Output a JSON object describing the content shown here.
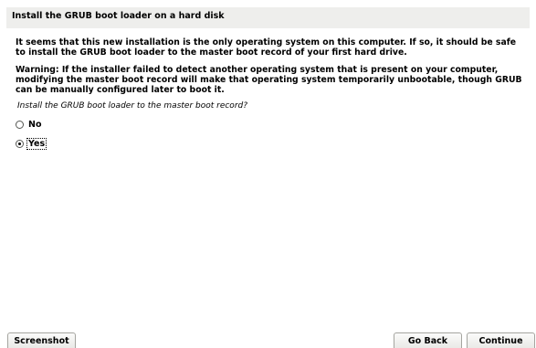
{
  "title": "Install the GRUB boot loader on a hard disk",
  "paragraphs": [
    "It seems that this new installation is the only operating system on this computer. If so, it should be safe to install the GRUB boot loader to the master boot record of your first hard drive.",
    "Warning: If the installer failed to detect another operating system that is present on your computer, modifying the master boot record will make that operating system temporarily unbootable, though GRUB can be manually configured later to boot it."
  ],
  "question": "Install the GRUB boot loader to the master boot record?",
  "options": [
    {
      "label": "No",
      "selected": false
    },
    {
      "label": "Yes",
      "selected": true
    }
  ],
  "buttons": {
    "screenshot": "Screenshot",
    "go_back": "Go Back",
    "continue": "Continue"
  }
}
